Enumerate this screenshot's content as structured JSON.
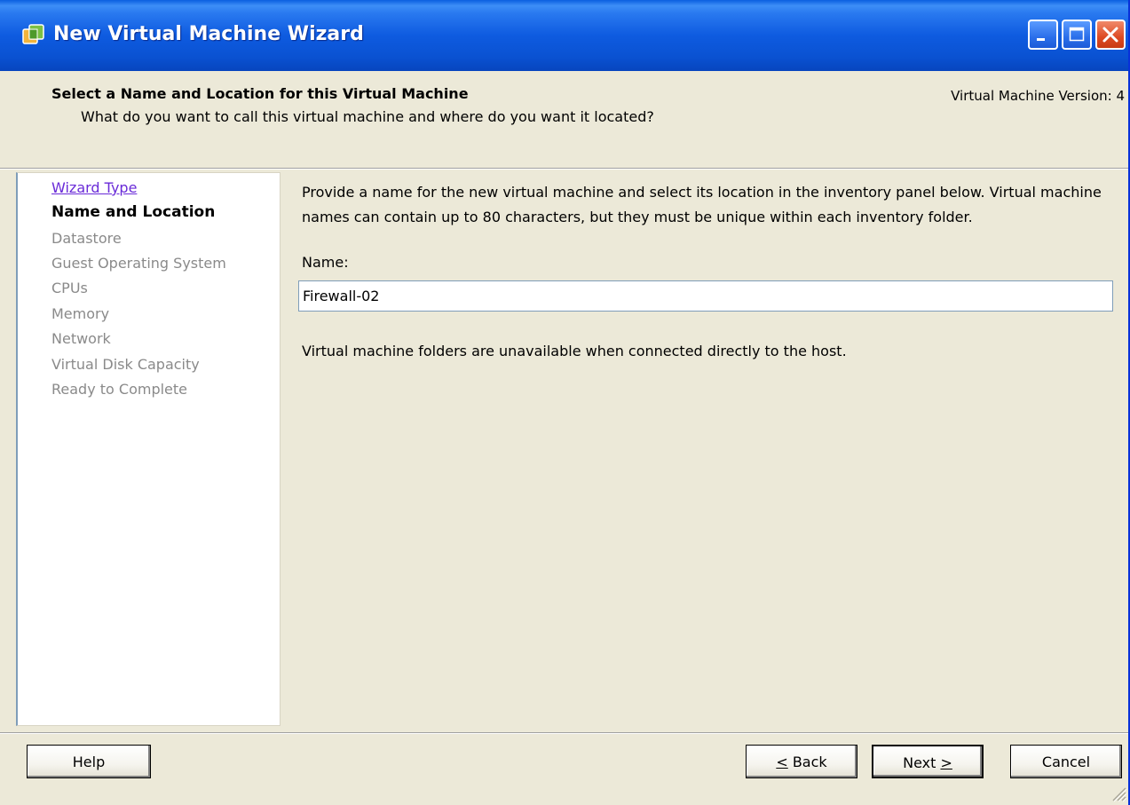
{
  "window": {
    "title": "New Virtual Machine Wizard",
    "icon": "vm-wizard-icon"
  },
  "header": {
    "title": "Select a Name and Location for this Virtual Machine",
    "subtitle": "What do you want to call this virtual machine and where do you want it located?",
    "version": "Virtual Machine Version: 4"
  },
  "steps": [
    {
      "label": "Wizard Type",
      "state": "link"
    },
    {
      "label": "Name and Location",
      "state": "current"
    },
    {
      "label": "Datastore",
      "state": "future"
    },
    {
      "label": "Guest Operating System",
      "state": "future"
    },
    {
      "label": "CPUs",
      "state": "future"
    },
    {
      "label": "Memory",
      "state": "future"
    },
    {
      "label": "Network",
      "state": "future"
    },
    {
      "label": "Virtual Disk Capacity",
      "state": "future"
    },
    {
      "label": "Ready to Complete",
      "state": "future"
    }
  ],
  "content": {
    "description": "Provide a name for the new virtual machine and select its location in the inventory panel below. Virtual machine names can contain up to 80 characters, but they must be unique within each inventory folder.",
    "name_label": "Name:",
    "name_value": "Firewall-02",
    "folder_note": "Virtual machine folders are unavailable when connected directly to the host."
  },
  "buttons": {
    "help": "Help",
    "back_key": "<",
    "back_rest": " Back",
    "next_rest": "Next ",
    "next_key": ">",
    "cancel": "Cancel"
  },
  "colors": {
    "titlebar": "#0A52D2",
    "dialog_bg": "#ECE9D8",
    "link": "#6A2BD8",
    "disabled_text": "#8A8A8A"
  }
}
